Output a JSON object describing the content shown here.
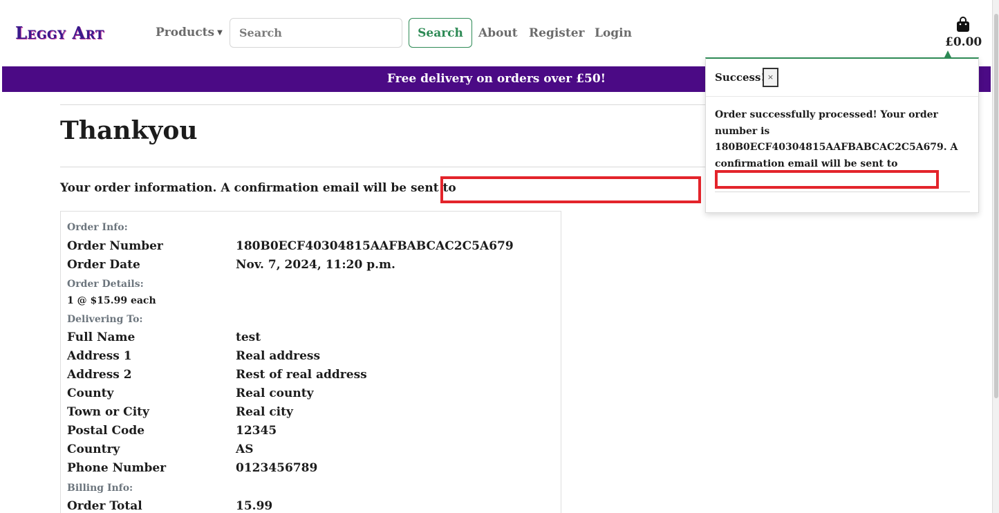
{
  "header": {
    "logo_text": "Leggy Art",
    "nav": {
      "products_label": "Products",
      "about_label": "About",
      "register_label": "Register",
      "login_label": "Login"
    },
    "search": {
      "placeholder": "Search",
      "button_label": "Search"
    },
    "bag": {
      "icon": "shopping-bag-icon",
      "amount": "£0.00"
    }
  },
  "banner": {
    "text": "Free delivery on orders over £50!"
  },
  "main": {
    "title": "Thankyou",
    "info_line": "Your order information. A confirmation email will be sent to",
    "order": {
      "order_info_label": "Order Info:",
      "order_number_label": "Order Number",
      "order_number_value": "180B0ECF40304815AAFBABCAC2C5A679",
      "order_date_label": "Order Date",
      "order_date_value": "Nov. 7, 2024, 11:20 p.m.",
      "order_details_label": "Order Details:",
      "item_line": "1 @ $15.99 each",
      "delivering_label": "Delivering To:",
      "full_name_label": "Full Name",
      "full_name_value": "test",
      "address1_label": "Address 1",
      "address1_value": "Real address",
      "address2_label": "Address 2",
      "address2_value": "Rest of real address",
      "county_label": "County",
      "county_value": "Real county",
      "town_label": "Town or City",
      "town_value": "Real city",
      "postal_label": "Postal Code",
      "postal_value": "12345",
      "country_label": "Country",
      "country_value": "AS",
      "phone_label": "Phone Number",
      "phone_value": "0123456789",
      "billing_label": "Billing Info:",
      "total_label": "Order Total",
      "total_value": "15.99"
    }
  },
  "toast": {
    "title": "Success!",
    "close_label": "×",
    "message": "Order successfully processed! Your order number is 180B0ECF40304815AAFBABCAC2C5A679. A confirmation email will be sent to"
  },
  "colors": {
    "banner_bg": "#4b0a85",
    "accent_green": "#2d8a55",
    "redaction": "#e3242b"
  }
}
